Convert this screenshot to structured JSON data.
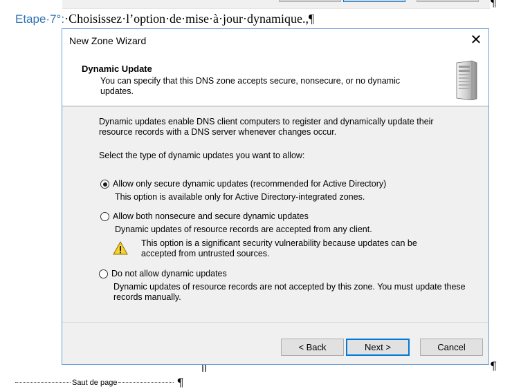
{
  "document": {
    "heading_step": "Etape·7°:",
    "heading_text": "·Choisissez·l’option·de·mise·à·jour·dynamique.,¶",
    "pilcrow": "¶",
    "page_break_label": "Saut de page"
  },
  "dialog": {
    "title": "New Zone Wizard",
    "close_glyph": "✕",
    "header": {
      "title": "Dynamic Update",
      "subtitle": "You can specify that this DNS zone accepts secure, nonsecure, or no dynamic updates."
    },
    "intro": "Dynamic updates enable DNS client computers to register and dynamically update their resource records with a DNS server whenever changes occur.",
    "prompt": "Select the type of dynamic updates you want to allow:",
    "options": [
      {
        "label": "Allow only secure dynamic updates (recommended for Active Directory)",
        "description": "This option is available only for Active Directory-integrated zones.",
        "selected": true
      },
      {
        "label": "Allow both nonsecure and secure dynamic updates",
        "description": "Dynamic updates of resource records are accepted from any client.",
        "warning": "This option is a significant security vulnerability because updates can be accepted from untrusted sources.",
        "selected": false
      },
      {
        "label": "Do not allow dynamic updates",
        "description": "Dynamic updates of resource records are not accepted by this zone. You must update these records manually.",
        "selected": false
      }
    ],
    "buttons": {
      "back": "< Back",
      "next": "Next >",
      "cancel": "Cancel"
    },
    "icons": {
      "header": "server-icon",
      "warning": "warning-icon"
    },
    "colors": {
      "accent": "#0078d7",
      "heading_step": "#2e74b5",
      "dialog_bg": "#f0f0f0"
    }
  }
}
